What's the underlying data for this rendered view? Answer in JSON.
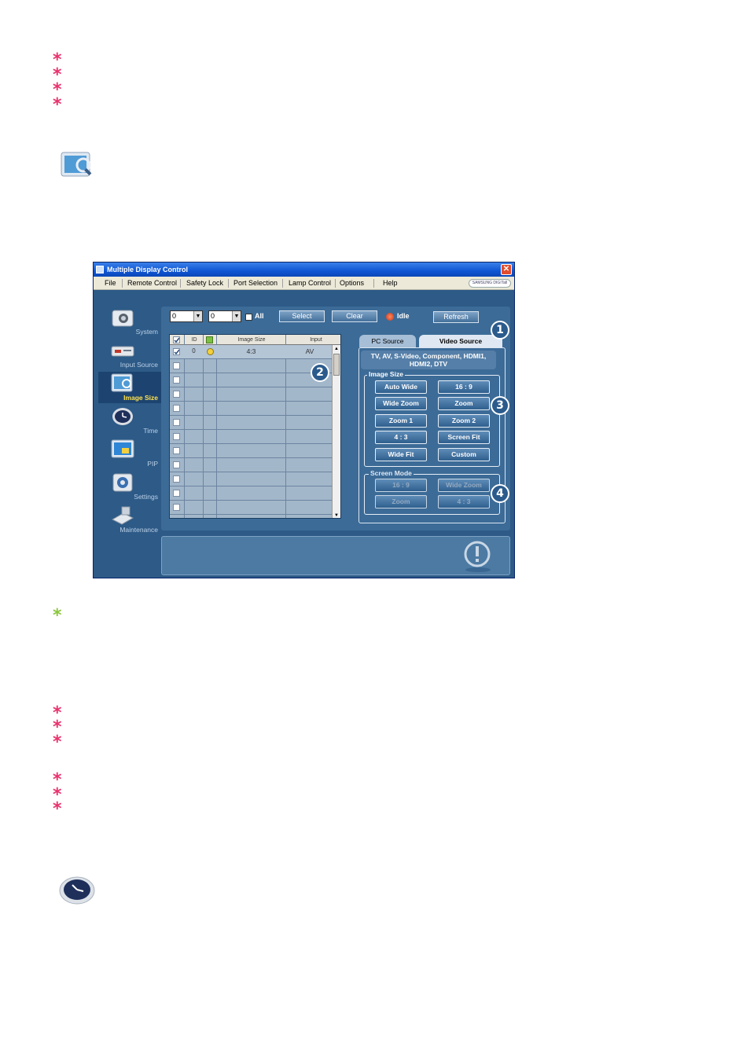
{
  "page": {
    "side_note_marker": "*",
    "bullets_top": [
      "*",
      "*",
      "*",
      "*"
    ],
    "bullets_mid": [
      "*",
      "*",
      "*"
    ],
    "bullets_low": [
      "*",
      "*",
      "*"
    ]
  },
  "icons": {
    "top_icon": "image-size-monitor-icon",
    "bottom_icon": "time-clock-icon"
  },
  "colors": {
    "bullet": "#e8336d",
    "note_bullet": "#8cc63f",
    "window_bg": "#2d5a87",
    "title_bar": "#0f56d4",
    "active_nav_label": "#ffe14d"
  },
  "window": {
    "title": "Multiple Display Control",
    "close_glyph": "✕",
    "brand": "SAMSUNG DIGITall",
    "menu": [
      "File",
      "Remote Control",
      "Safety Lock",
      "Port Selection",
      "Lamp Control",
      "Options",
      "Help"
    ]
  },
  "sidebar": {
    "items": [
      {
        "label": "System",
        "icon": "system-camera-icon",
        "active": false
      },
      {
        "label": "Input Source",
        "icon": "input-source-icon",
        "active": false
      },
      {
        "label": "Image Size",
        "icon": "image-size-icon",
        "active": true
      },
      {
        "label": "Time",
        "icon": "clock-icon",
        "active": false
      },
      {
        "label": "PIP",
        "icon": "pip-icon",
        "active": false
      },
      {
        "label": "Settings",
        "icon": "settings-icon",
        "active": false
      },
      {
        "label": "Maintenance",
        "icon": "maintenance-icon",
        "active": false
      }
    ]
  },
  "toolbar": {
    "combo1_value": "0",
    "combo2_value": "0",
    "all_label": "All",
    "select_label": "Select",
    "clear_label": "Clear",
    "status_label": "Idle",
    "refresh_label": "Refresh"
  },
  "grid": {
    "columns": [
      "ID",
      "Image Size",
      "Input"
    ],
    "rows": [
      {
        "checked": true,
        "id": "0",
        "power": "on",
        "image_size": "4:3",
        "input": "AV"
      }
    ],
    "empty_rows": 11
  },
  "callouts": [
    "1",
    "2",
    "3",
    "4"
  ],
  "tabs": {
    "pc_source": "PC Source",
    "video_source": "Video Source",
    "active": "Video Source"
  },
  "source_list": "TV, AV, S-Video, Component, HDMI1, HDMI2, DTV",
  "image_size": {
    "title": "Image Size",
    "buttons": [
      "Auto Wide",
      "16 : 9",
      "Wide Zoom",
      "Zoom",
      "Zoom 1",
      "Zoom 2",
      "4 : 3",
      "Screen Fit",
      "Wide Fit",
      "Custom"
    ]
  },
  "screen_mode": {
    "title": "Screen Mode",
    "buttons": [
      "16 : 9",
      "Wide Zoom",
      "Zoom",
      "4 : 3"
    ]
  }
}
